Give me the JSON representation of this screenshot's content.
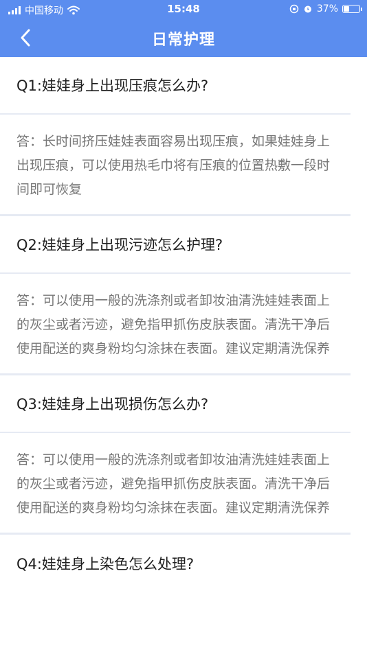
{
  "status_bar": {
    "carrier": "中国移动",
    "time": "15:48",
    "battery_percent": "37%",
    "battery_level": 0.37
  },
  "nav": {
    "title": "日常护理"
  },
  "faq": [
    {
      "question": "Q1:娃娃身上出现压痕怎么办?",
      "answer": "答：长时间挤压娃娃表面容易出现压痕，如果娃娃身上出现压痕，可以使用热毛巾将有压痕的位置热敷一段时间即可恢复"
    },
    {
      "question": "Q2:娃娃身上出现污迹怎么护理?",
      "answer": "答：可以使用一般的洗涤剂或者卸妆油清洗娃娃表面上的灰尘或者污迹，避免指甲抓伤皮肤表面。清洗干净后使用配送的爽身粉均匀涂抹在表面。建议定期清洗保养"
    },
    {
      "question": "Q3:娃娃身上出现损伤怎么办?",
      "answer": "答：可以使用一般的洗涤剂或者卸妆油清洗娃娃表面上的灰尘或者污迹，避免指甲抓伤皮肤表面。清洗干净后使用配送的爽身粉均匀涂抹在表面。建议定期清洗保养"
    },
    {
      "question": "Q4:娃娃身上染色怎么处理?"
    }
  ]
}
